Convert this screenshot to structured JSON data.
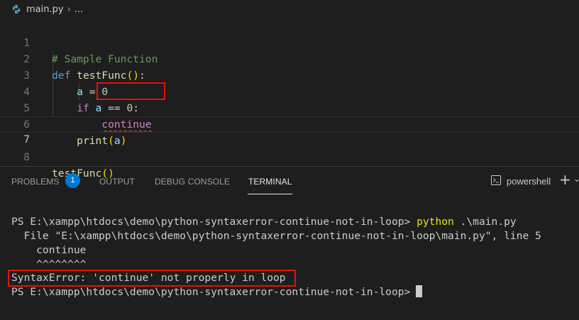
{
  "breadcrumb": {
    "file": "main.py",
    "separator": "›",
    "ellipsis": "..."
  },
  "editor": {
    "lines": [
      {
        "n": "1",
        "comment": "# Sample Function"
      },
      {
        "n": "2",
        "def": "def",
        "name": "testFunc",
        "open": "(",
        "close": ")",
        "colon": ":"
      },
      {
        "n": "3",
        "var": "a",
        "eq": " = ",
        "num": "0"
      },
      {
        "n": "4",
        "kw": "if",
        "var": "a",
        "op": " == ",
        "num": "0",
        "colon": ":"
      },
      {
        "n": "5",
        "kw": "continue"
      },
      {
        "n": "6",
        "func": "print",
        "open": "(",
        "var": "a",
        "close": ")"
      },
      {
        "n": "7"
      },
      {
        "n": "8",
        "func": "testFunc",
        "open": "(",
        "close": ")"
      }
    ]
  },
  "panel": {
    "tabs": [
      "PROBLEMS",
      "OUTPUT",
      "DEBUG CONSOLE",
      "TERMINAL"
    ],
    "active_tab": "TERMINAL",
    "problems_count": "1",
    "shell": "powershell",
    "add_icon": "plus-icon"
  },
  "terminal": {
    "prompt1": "PS E:\\xampp\\htdocs\\demo\\python-syntaxerror-continue-not-in-loop> ",
    "cmd1_a": "python",
    "cmd1_b": " .\\main.py",
    "line2": "  File \"E:\\xampp\\htdocs\\demo\\python-syntaxerror-continue-not-in-loop\\main.py\", line 5",
    "line3": "    continue",
    "line4": "    ^^^^^^^^",
    "line5": "SyntaxError: 'continue' not properly in loop",
    "prompt2": "PS E:\\xampp\\htdocs\\demo\\python-syntaxerror-continue-not-in-loop>"
  },
  "colors": {
    "background": "#1e1e1e",
    "highlight_box": "#e51400",
    "badge": "#0078d4"
  }
}
